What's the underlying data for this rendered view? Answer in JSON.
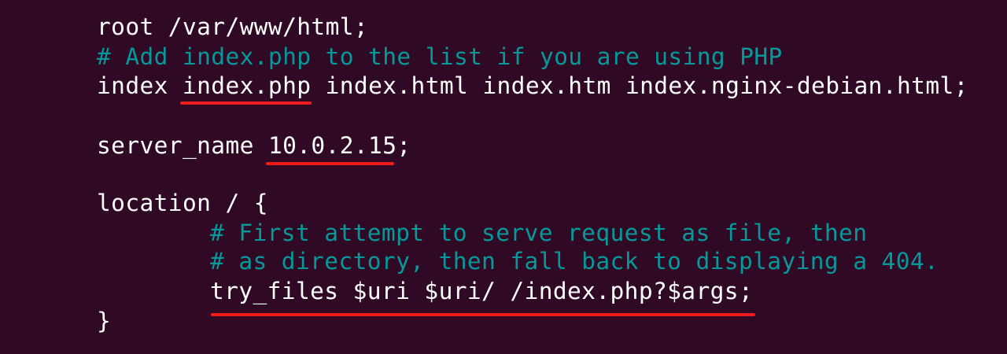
{
  "code": {
    "root_line": "root /var/www/html;",
    "comment_add_index": "# Add index.php to the list if you are using PHP",
    "index_keyword": "index ",
    "index_php": "index.php",
    "index_rest": " index.html index.htm index.nginx-debian.html;",
    "server_name_keyword": "server_name ",
    "server_name_value": "10.0.2.15",
    "server_name_semicolon": ";",
    "location_open": "location / {",
    "comment_first_attempt": "# First attempt to serve request as file, then",
    "comment_as_directory": "# as directory, then fall back to displaying a 404.",
    "try_files_line": "try_files $uri $uri/ /index.php?$args;",
    "location_close": "}"
  },
  "colors": {
    "background": "#300a24",
    "text": "#ffffff",
    "comment": "#06989a",
    "annotation_underline": "#ee1c1c"
  }
}
